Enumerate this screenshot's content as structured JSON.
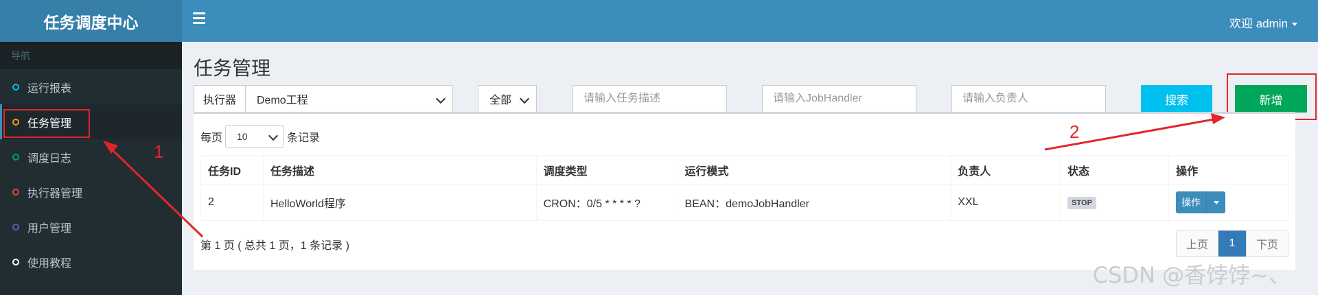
{
  "app": {
    "brand": "任务调度中心",
    "welcome": "欢迎 admin"
  },
  "sidebar": {
    "header": "导航",
    "items": [
      {
        "label": "运行报表",
        "color": "#00c0ef"
      },
      {
        "label": "任务管理",
        "color": "#f39c12"
      },
      {
        "label": "调度日志",
        "color": "#00a65a"
      },
      {
        "label": "执行器管理",
        "color": "#dd4b39"
      },
      {
        "label": "用户管理",
        "color": "#605ca8"
      },
      {
        "label": "使用教程",
        "color": "#ffffff"
      }
    ]
  },
  "page": {
    "title": "任务管理"
  },
  "filters": {
    "executor_label": "执行器",
    "executor_value": "Demo工程",
    "status_value": "全部",
    "desc_placeholder": "请输入任务描述",
    "handler_placeholder": "请输入JobHandler",
    "owner_placeholder": "请输入负责人",
    "search_label": "搜索",
    "add_label": "新增"
  },
  "list": {
    "perpage_prefix": "每页",
    "perpage_value": "10",
    "perpage_suffix": "条记录",
    "columns": [
      "任务ID",
      "任务描述",
      "调度类型",
      "运行模式",
      "负责人",
      "状态",
      "操作"
    ],
    "rows": [
      {
        "id": "2",
        "desc": "HelloWorld程序",
        "schedule": "CRON：0/5 * * * * ?",
        "mode": "BEAN：demoJobHandler",
        "owner": "XXL",
        "status": "STOP",
        "action": "操作"
      }
    ],
    "info": "第 1 页 ( 总共 1 页，1 条记录 )",
    "pager": {
      "prev": "上页",
      "current": "1",
      "next": "下页"
    }
  },
  "annotations": {
    "one": "1",
    "two": "2"
  },
  "watermark": "CSDN @香饽饽~、"
}
